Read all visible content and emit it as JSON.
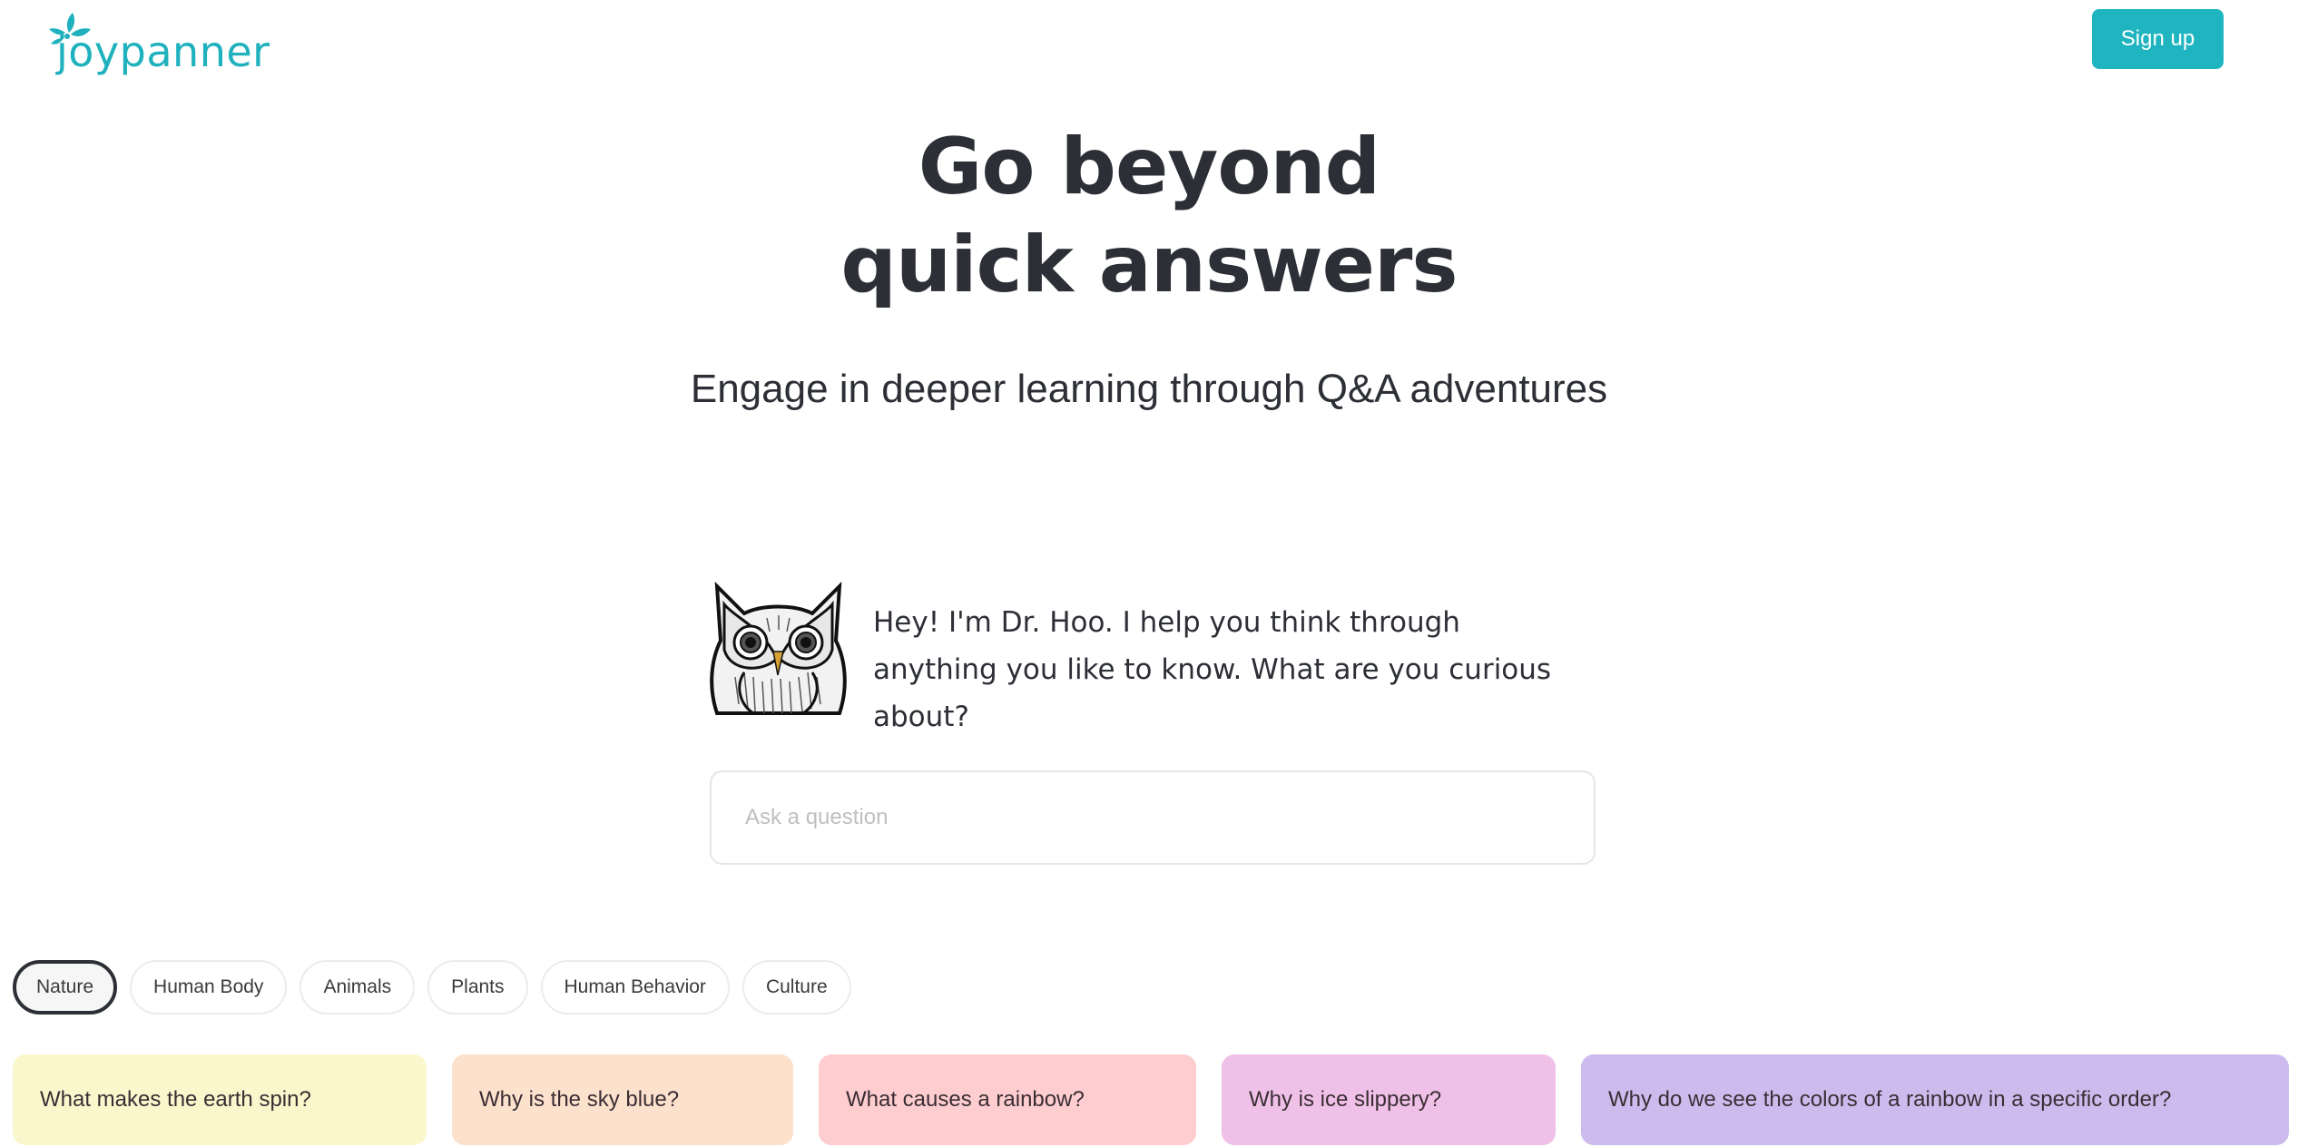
{
  "header": {
    "logo_text": "joypanner",
    "signup_label": "Sign up",
    "brand_color": "#1fb5c0"
  },
  "hero": {
    "title_line1": "Go beyond",
    "title_line2": "quick answers",
    "subtitle": "Engage in deeper learning through Q&A adventures"
  },
  "assistant": {
    "avatar_icon": "owl-icon",
    "intro_text": "Hey! I'm Dr. Hoo. I help you think through anything you like to know. What are you curious about?"
  },
  "search": {
    "placeholder": "Ask a question",
    "value": ""
  },
  "categories": [
    {
      "label": "Nature",
      "active": true
    },
    {
      "label": "Human Body",
      "active": false
    },
    {
      "label": "Animals",
      "active": false
    },
    {
      "label": "Plants",
      "active": false
    },
    {
      "label": "Human Behavior",
      "active": false
    },
    {
      "label": "Culture",
      "active": false
    }
  ],
  "questions": [
    {
      "text": "What makes the earth spin?",
      "color": "#fbf7cd"
    },
    {
      "text": "Why is the sky blue?",
      "color": "#fce1cd"
    },
    {
      "text": "What causes a rainbow?",
      "color": "#fdcdd0"
    },
    {
      "text": "Why is ice slippery?",
      "color": "#f0c1e8"
    },
    {
      "text": "Why do we see the colors of a rainbow in a specific order?",
      "color": "#cdbbee"
    }
  ]
}
